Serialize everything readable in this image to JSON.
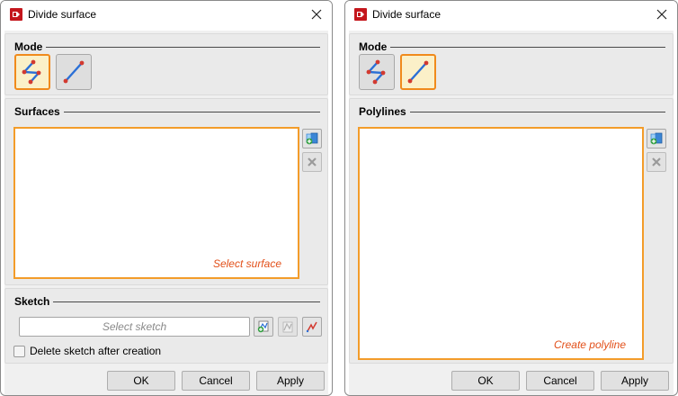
{
  "left_dialog": {
    "title": "Divide surface",
    "mode_label": "Mode",
    "surfaces_label": "Surfaces",
    "surfaces_hint": "Select surface",
    "sketch_label": "Sketch",
    "sketch_placeholder": "Select sketch",
    "delete_sketch_label": "Delete sketch after creation",
    "delete_sketch_checked": false,
    "active_mode": "surface-split",
    "ok_label": "OK",
    "cancel_label": "Cancel",
    "apply_label": "Apply"
  },
  "right_dialog": {
    "title": "Divide surface",
    "mode_label": "Mode",
    "polylines_label": "Polylines",
    "polylines_hint": "Create polyline",
    "active_mode": "polyline",
    "ok_label": "OK",
    "cancel_label": "Cancel",
    "apply_label": "Apply"
  },
  "icons": {
    "app": "app-icon",
    "close": "close-icon",
    "mode_split": "split-mode-icon",
    "mode_line": "line-mode-icon",
    "add": "add-item-icon",
    "remove": "remove-item-icon",
    "pick_sketch": "pick-sketch-icon",
    "edit_sketch": "edit-sketch-icon",
    "draw_sketch": "draw-sketch-icon"
  },
  "colors": {
    "accent_orange": "#f39c2a",
    "hint_red": "#e2501a",
    "line_blue": "#2a6fd6",
    "point_red": "#d23a30",
    "active_fill": "#fbf0c8"
  }
}
